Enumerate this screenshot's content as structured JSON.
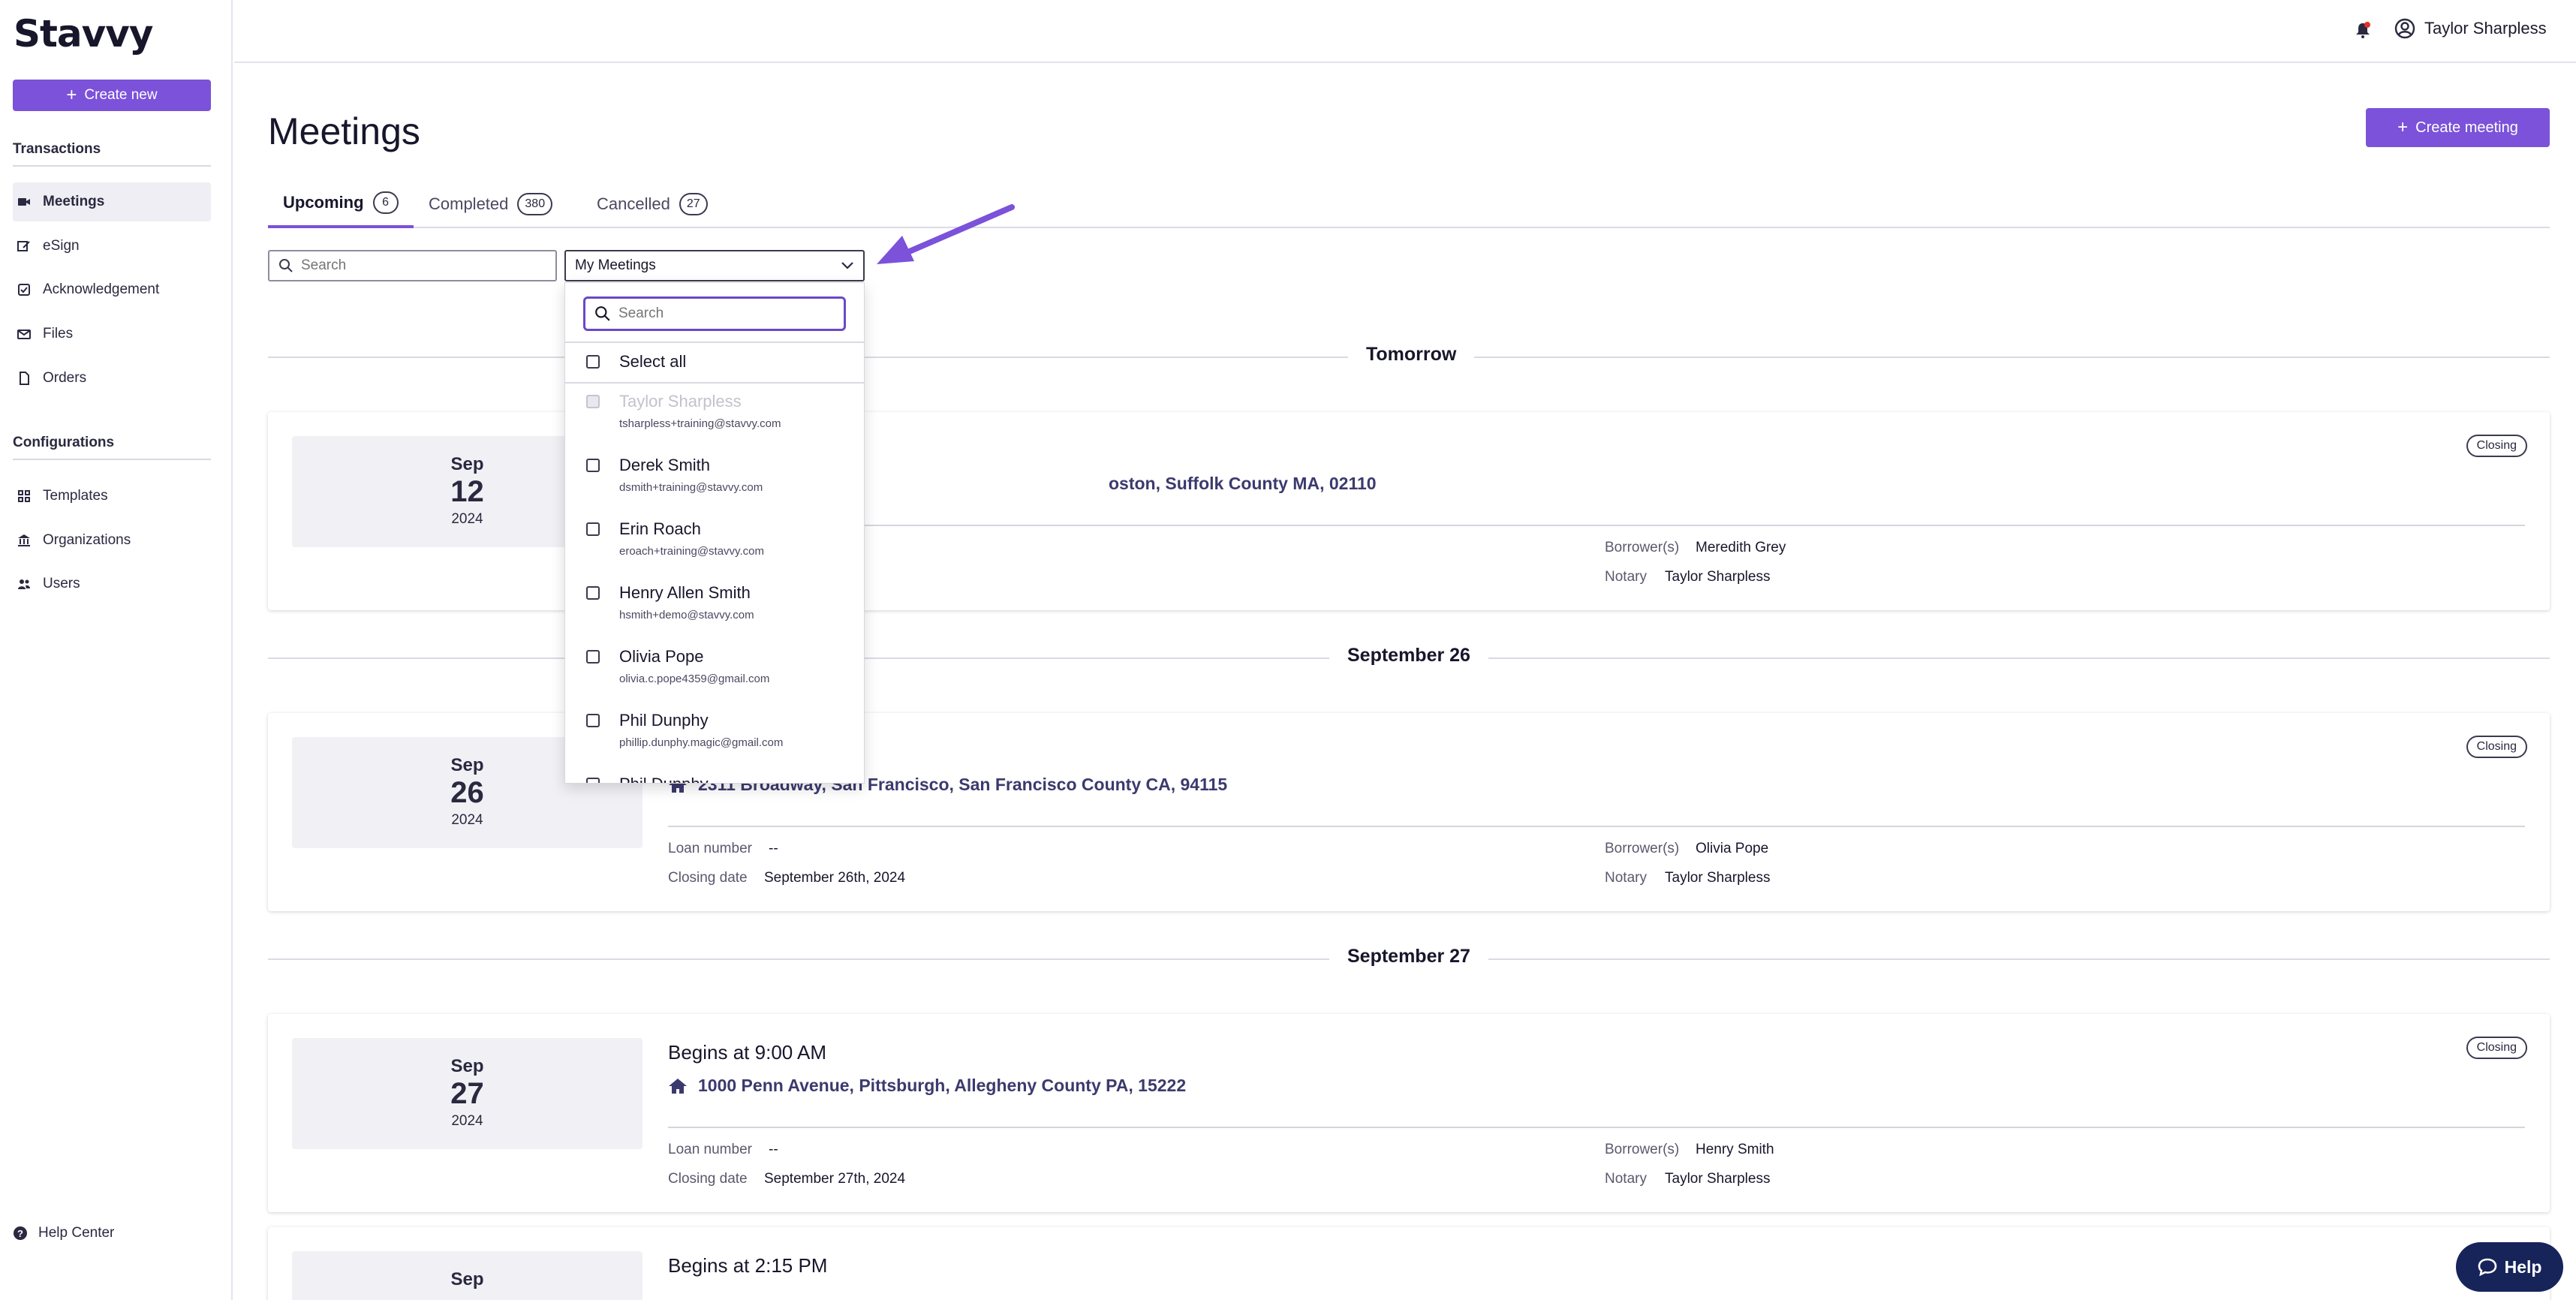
{
  "brand": {
    "logo": "Stavvy",
    "accent": "#7b52d9"
  },
  "sidebar": {
    "create_new": "Create new",
    "section_transactions": "Transactions",
    "transactions": [
      {
        "label": "Meetings",
        "icon": "video-icon",
        "active": true
      },
      {
        "label": "eSign",
        "icon": "pen-icon"
      },
      {
        "label": "Acknowledgement",
        "icon": "check-square-icon"
      },
      {
        "label": "Files",
        "icon": "mail-icon"
      },
      {
        "label": "Orders",
        "icon": "document-icon"
      }
    ],
    "section_configurations": "Configurations",
    "configurations": [
      {
        "label": "Templates",
        "icon": "templates-icon"
      },
      {
        "label": "Organizations",
        "icon": "bank-icon"
      },
      {
        "label": "Users",
        "icon": "users-icon"
      }
    ],
    "help_center": "Help Center"
  },
  "topbar": {
    "user_name": "Taylor Sharpless"
  },
  "main": {
    "title": "Meetings",
    "create_meeting": "Create meeting",
    "tabs": [
      {
        "label": "Upcoming",
        "count": "6",
        "active": true
      },
      {
        "label": "Completed",
        "count": "380"
      },
      {
        "label": "Cancelled",
        "count": "27"
      }
    ],
    "search_placeholder": "Search",
    "filter_value": "My Meetings"
  },
  "dropdown": {
    "search_placeholder": "Search",
    "select_all": "Select all",
    "people": [
      {
        "name": "Taylor Sharpless",
        "email": "tsharpless+training@stavvy.com",
        "disabled": true
      },
      {
        "name": "Derek Smith",
        "email": "dsmith+training@stavvy.com"
      },
      {
        "name": "Erin Roach",
        "email": "eroach+training@stavvy.com"
      },
      {
        "name": "Henry Allen Smith",
        "email": "hsmith+demo@stavvy.com"
      },
      {
        "name": "Olivia Pope",
        "email": "olivia.c.pope4359@gmail.com"
      },
      {
        "name": "Phil Dunphy",
        "email": "phillip.dunphy.magic@gmail.com"
      },
      {
        "name": "Phil Dunphy",
        "email": ""
      }
    ]
  },
  "groups": [
    {
      "label": "Tomorrow"
    },
    {
      "label": "September 26"
    },
    {
      "label": "September 27"
    }
  ],
  "meetings": [
    {
      "month": "Sep",
      "day": "12",
      "year": "2024",
      "begins": "",
      "address": "oston, Suffolk County MA, 02110",
      "loan_label": "",
      "loan": "",
      "closing_label": "",
      "closing": "",
      "borrower_label": "Borrower(s)",
      "borrower": "Meredith Grey",
      "notary_label": "Notary",
      "notary": "Taylor Sharpless",
      "type": "Closing"
    },
    {
      "month": "Sep",
      "day": "26",
      "year": "2024",
      "begins": "",
      "address": "2311 Broadway, San Francisco, San Francisco County CA, 94115",
      "loan_label": "Loan number",
      "loan": "--",
      "closing_label": "Closing date",
      "closing": "September 26th, 2024",
      "borrower_label": "Borrower(s)",
      "borrower": "Olivia Pope",
      "notary_label": "Notary",
      "notary": "Taylor Sharpless",
      "type": "Closing"
    },
    {
      "month": "Sep",
      "day": "27",
      "year": "2024",
      "begins": "Begins at 9:00 AM",
      "address": "1000 Penn Avenue, Pittsburgh, Allegheny County PA, 15222",
      "loan_label": "Loan number",
      "loan": "--",
      "closing_label": "Closing date",
      "closing": "September 27th, 2024",
      "borrower_label": "Borrower(s)",
      "borrower": "Henry Smith",
      "notary_label": "Notary",
      "notary": "Taylor Sharpless",
      "type": "Closing"
    },
    {
      "month": "Sep",
      "day": "",
      "year": "",
      "begins": "Begins at 2:15 PM"
    }
  ],
  "help_fab": "Help"
}
